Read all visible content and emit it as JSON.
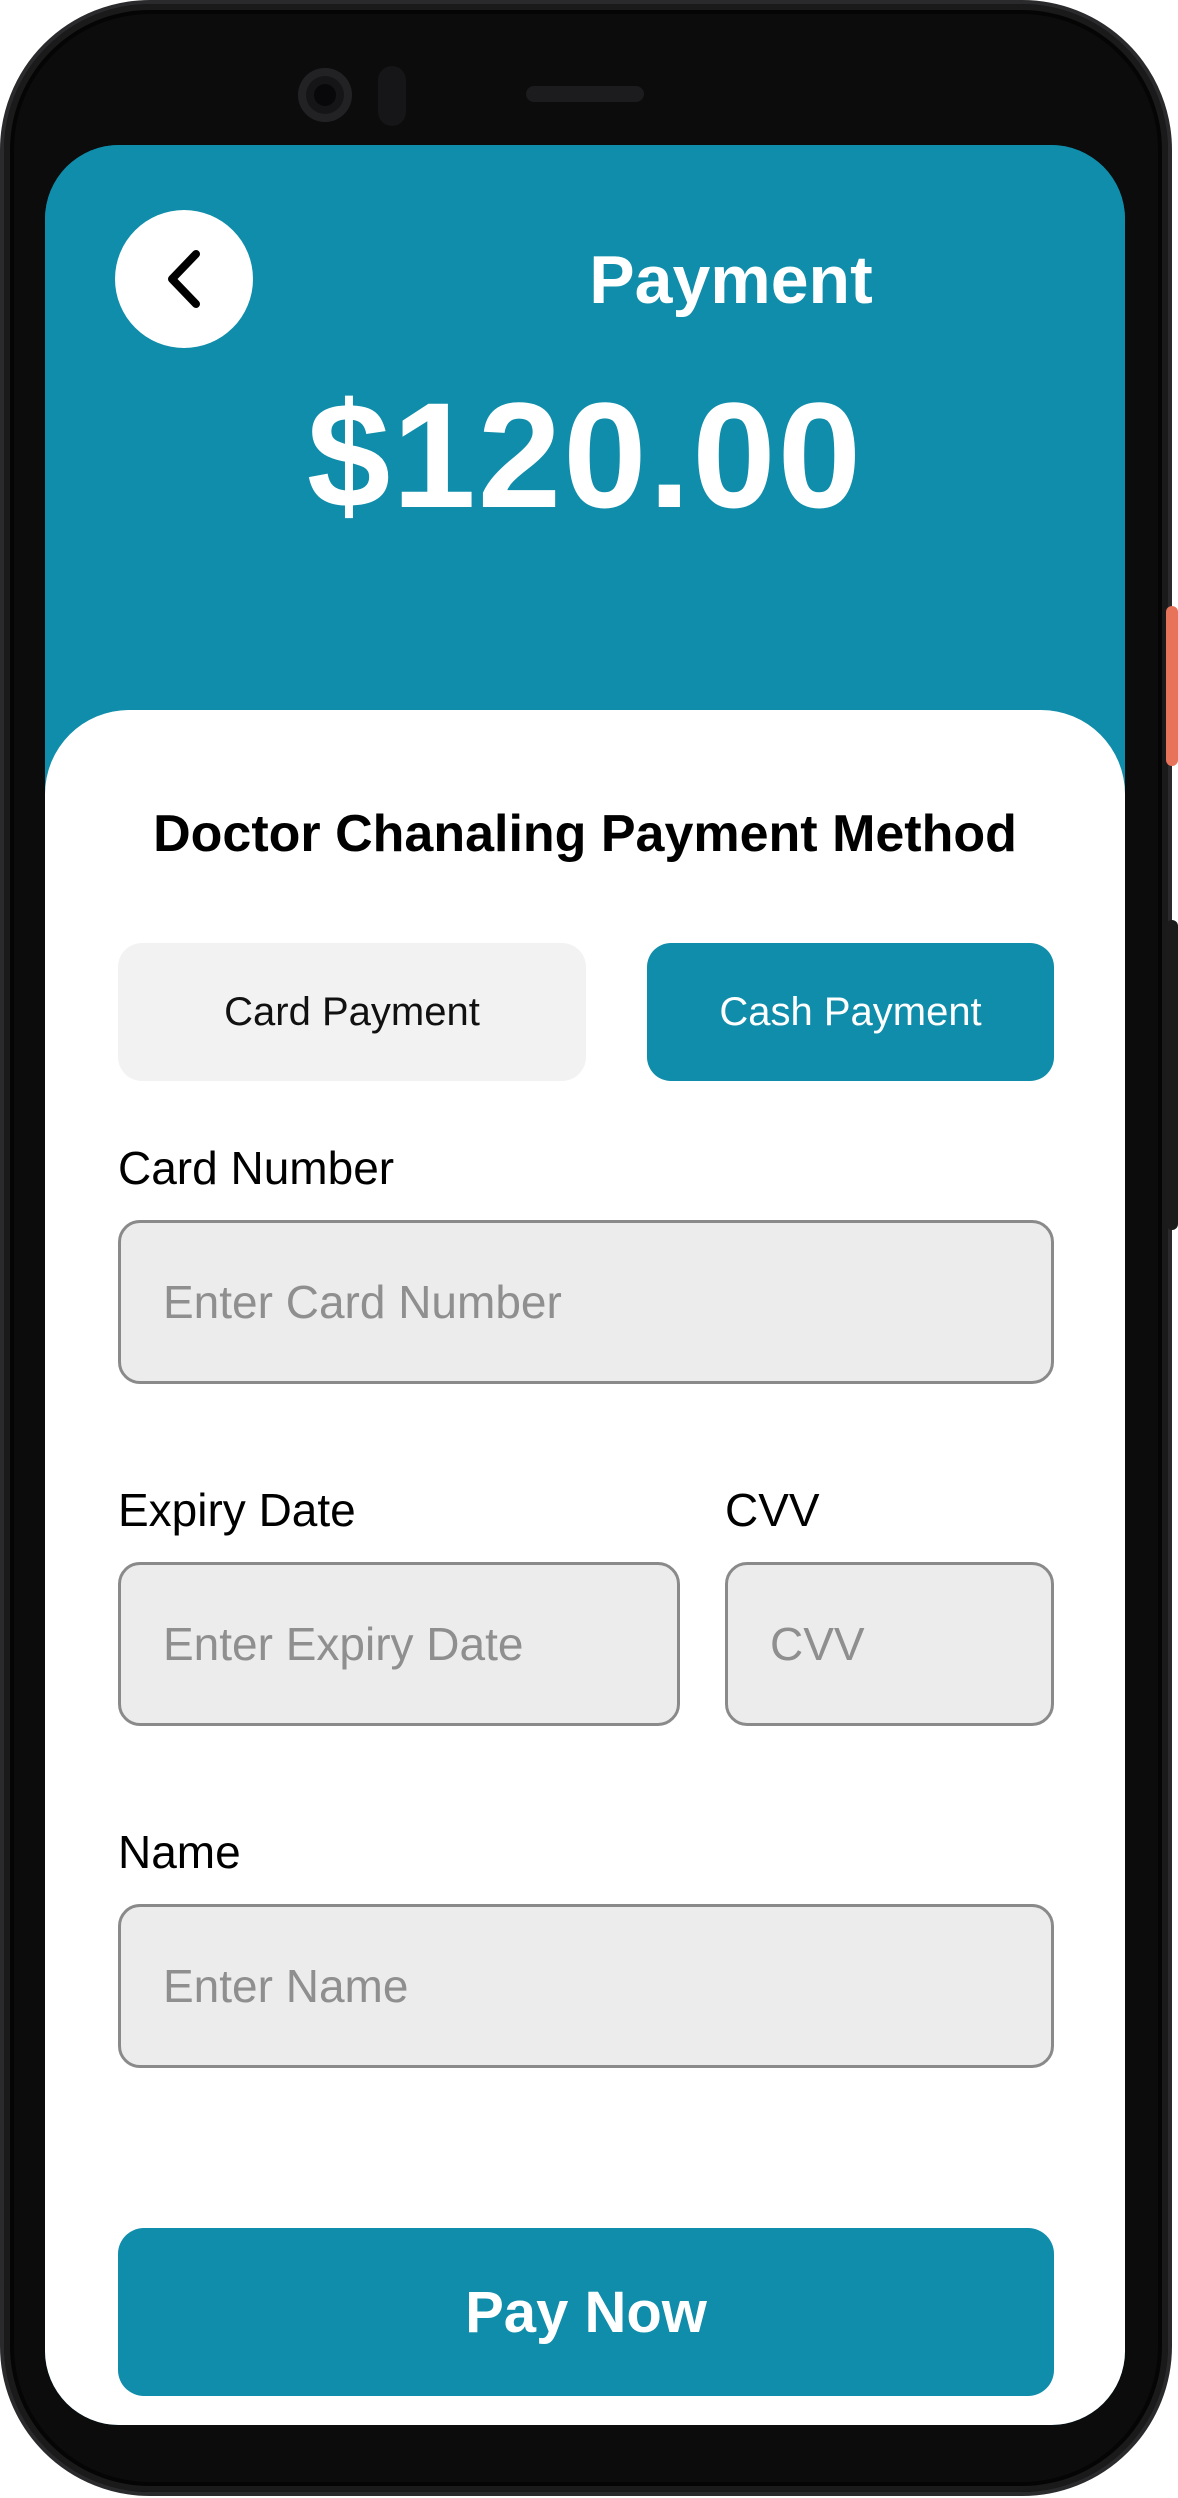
{
  "header": {
    "title": "Payment",
    "amount": "$120.00",
    "back_icon": "chevron-left-icon"
  },
  "payment": {
    "method_title": "Doctor Chanaling Payment Method",
    "tabs": [
      {
        "label": "Card Payment",
        "active": false
      },
      {
        "label": "Cash Payment",
        "active": true
      }
    ]
  },
  "form": {
    "card_number": {
      "label": "Card Number",
      "placeholder": "Enter Card Number",
      "value": ""
    },
    "expiry": {
      "label": "Expiry Date",
      "placeholder": "Enter Expiry Date",
      "value": ""
    },
    "cvv": {
      "label": "CVV",
      "placeholder": "CVV",
      "value": ""
    },
    "name": {
      "label": "Name",
      "placeholder": "Enter Name",
      "value": ""
    }
  },
  "actions": {
    "pay_label": "Pay Now"
  },
  "colors": {
    "accent": "#0f8daa",
    "tab_inactive": "#f2f2f2",
    "field_bg": "#ececec",
    "side_button": "#e7735b"
  }
}
